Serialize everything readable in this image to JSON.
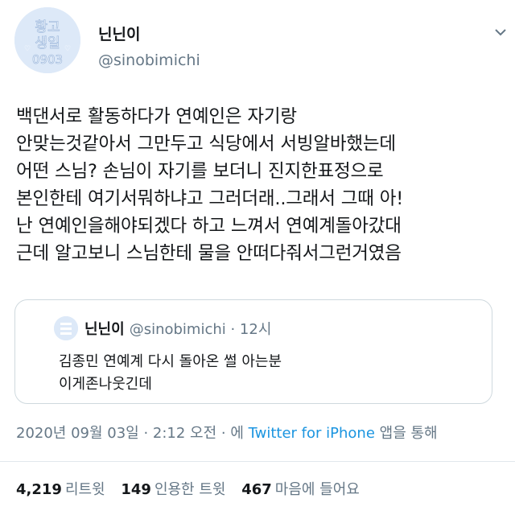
{
  "author": {
    "display_name": "닌닌이",
    "handle": "@sinobimichi",
    "avatar_text": [
      "황고",
      "생일",
      "0903"
    ]
  },
  "tweet": {
    "lines": [
      "백댄서로 활동하다가 연예인은 자기랑",
      "안맞는것같아서 그만두고 식당에서 서빙알바했는데",
      "어떤 스님? 손님이 자기를 보더니 진지한표정으로",
      "본인한테 여기서뭐하냐고 그러더래..그래서 그때 아!",
      "난 연예인을해야되겠다 하고 느껴서 연예계돌아갔대",
      "근데 알고보니 스님한테 물을 안떠다줘서그런거였음"
    ]
  },
  "quoted_tweet": {
    "display_name": "닌닌이",
    "handle_time": "@sinobimichi · 12시",
    "lines": [
      "김종민 연예계 다시 돌아온 썰 아는분",
      "이게존나웃긴데"
    ]
  },
  "meta": {
    "timestamp": "2020년 09월 03일 · 2:12 오전 · 에 ",
    "source": "Twitter for iPhone",
    "suffix": " 앱을 통해"
  },
  "stats": [
    {
      "count": "4,219",
      "label": "리트윗"
    },
    {
      "count": "149",
      "label": "인용한 트윗"
    },
    {
      "count": "467",
      "label": "마음에 들어요"
    }
  ],
  "colors": {
    "text": "#14171a",
    "secondary": "#657786",
    "link": "#1b95e0",
    "avatar_bg": "#dde9f8",
    "border": "#cfd9de"
  }
}
